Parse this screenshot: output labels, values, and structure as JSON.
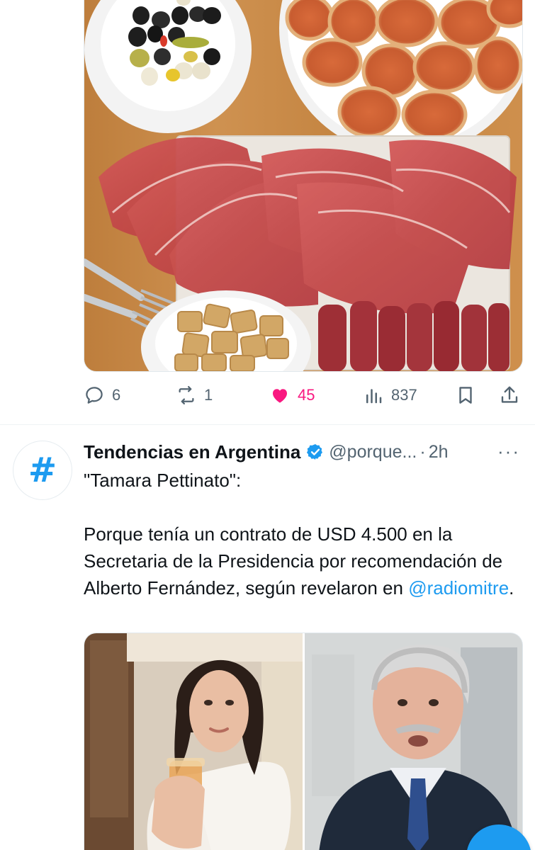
{
  "tweet1": {
    "media_alt": "",
    "actions": {
      "replies": "6",
      "retweets": "1",
      "likes": "45",
      "views": "837"
    },
    "liked": true,
    "like_color": "#f91880"
  },
  "tweet2": {
    "avatar_symbol": "#",
    "author": "Tendencias en Argentina",
    "handle": "@porque...",
    "dot": "·",
    "time": "2h",
    "more": "···",
    "text_line1": "\"Tamara Pettinato\":",
    "text_body": "Porque tenía un contrato de USD 4.500 en la Secretaria de la Presidencia por recomendación de Alberto Fernández, según revelaron en ",
    "mention": "@radiomitre",
    "text_end": "."
  },
  "icons": {
    "reply": "reply-icon",
    "retweet": "retweet-icon",
    "like": "heart-icon",
    "views": "views-icon",
    "bookmark": "bookmark-icon",
    "share": "share-icon",
    "verified": "verified-badge-icon"
  },
  "colors": {
    "accent": "#1d9bf0",
    "text": "#0f1419",
    "secondary": "#536471",
    "like": "#f91880"
  }
}
